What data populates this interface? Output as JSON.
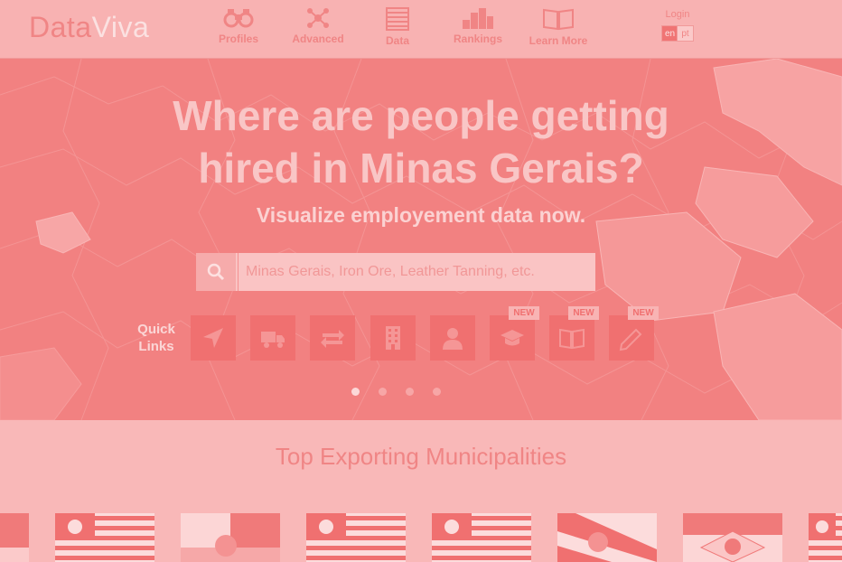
{
  "header": {
    "logo_part1": "Data",
    "logo_part2": "Viva",
    "nav": [
      {
        "label": "Profiles",
        "icon": "binoculars-icon"
      },
      {
        "label": "Advanced",
        "icon": "network-icon"
      },
      {
        "label": "Data",
        "icon": "table-icon"
      },
      {
        "label": "Rankings",
        "icon": "bar-chart-icon"
      },
      {
        "label": "Learn More",
        "icon": "book-icon"
      }
    ],
    "login": "Login",
    "languages": [
      "en",
      "pt"
    ],
    "selected_language": "en"
  },
  "hero": {
    "headline_line1": "Where are people getting",
    "headline_line2": "hired in Minas Gerais?",
    "subheadline": "Visualize employement data now.",
    "search": {
      "placeholder": "Minas Gerais, Iron Ore, Leather Tanning, etc.",
      "value": ""
    },
    "quick_links_label_line1": "Quick",
    "quick_links_label_line2": "Links",
    "quick_links": [
      {
        "icon": "location-arrow-icon",
        "new": false
      },
      {
        "icon": "truck-icon",
        "new": false
      },
      {
        "icon": "exchange-icon",
        "new": false
      },
      {
        "icon": "building-icon",
        "new": false
      },
      {
        "icon": "user-icon",
        "new": false
      },
      {
        "icon": "graduation-cap-icon",
        "new": true
      },
      {
        "icon": "open-book-icon",
        "new": true
      },
      {
        "icon": "pencil-icon",
        "new": true
      }
    ],
    "new_badge": "NEW",
    "carousel_dots": 4,
    "active_dot": 0
  },
  "section": {
    "title": "Top Exporting Municipalities",
    "flags": [
      "partial-flag-icon",
      "sao-paulo-flag-icon",
      "municipal-flag-icon",
      "sao-paulo-flag-icon",
      "sao-paulo-flag-icon",
      "diagonal-flag-icon",
      "crest-flag-icon",
      "sao-paulo-flag-icon"
    ]
  },
  "colors": {
    "overlay": "#f9b8b8",
    "hero": "#f28181",
    "accent": "#f07070"
  }
}
